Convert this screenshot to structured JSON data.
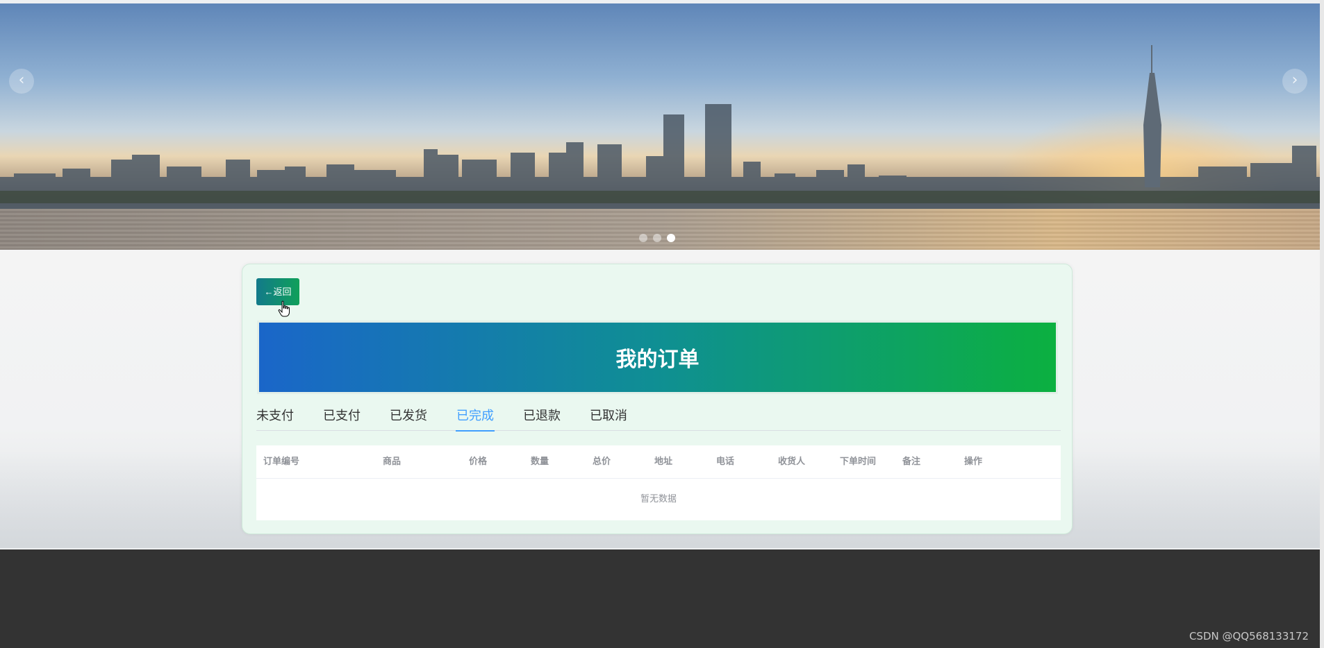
{
  "carousel": {
    "prev_icon": "chevron-left-icon",
    "next_icon": "chevron-right-icon",
    "prev_glyph": "‹",
    "next_glyph": "›",
    "slide_count": 3,
    "active_slide": 3
  },
  "card": {
    "back_label": "←返回",
    "title": "我的订单"
  },
  "tabs": [
    {
      "label": "未支付",
      "active": false
    },
    {
      "label": "已支付",
      "active": false
    },
    {
      "label": "已发货",
      "active": false
    },
    {
      "label": "已完成",
      "active": true
    },
    {
      "label": "已退款",
      "active": false
    },
    {
      "label": "已取消",
      "active": false
    }
  ],
  "table": {
    "columns": [
      "订单编号",
      "商品",
      "价格",
      "数量",
      "总价",
      "地址",
      "电话",
      "收货人",
      "下单时间",
      "备注",
      "操作"
    ],
    "empty_text": "暂无数据"
  },
  "watermark": "CSDN @QQ568133172",
  "colors": {
    "accent": "#409eff",
    "title_gradient_start": "#1a66c9",
    "title_gradient_end": "#0cb040",
    "footer": "#333333"
  }
}
